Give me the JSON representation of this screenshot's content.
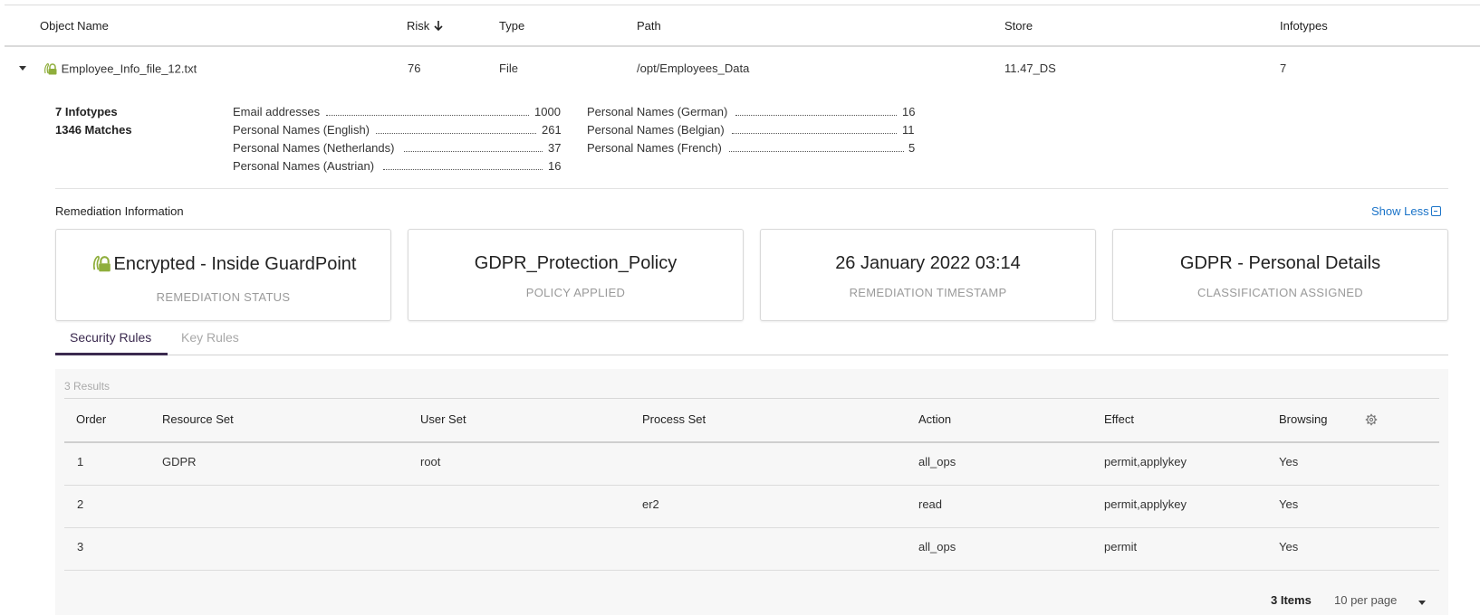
{
  "table": {
    "headers": {
      "object_name": "Object Name",
      "risk": "Risk",
      "type": "Type",
      "path": "Path",
      "store": "Store",
      "infotypes": "Infotypes"
    },
    "row": {
      "object_name": "Employee_Info_file_12.txt",
      "risk": "76",
      "type": "File",
      "path": "/opt/Employees_Data",
      "store": "11.47_DS",
      "infotypes": "7"
    }
  },
  "details": {
    "infotypes_summary": "7 Infotypes",
    "matches_summary": "1346 Matches",
    "infotypes_col1": [
      {
        "label": "Email addresses",
        "value": "1000"
      },
      {
        "label": "Personal Names (English)",
        "value": "261"
      },
      {
        "label": "Personal Names (Netherlands)",
        "value": "37"
      },
      {
        "label": "Personal Names (Austrian)",
        "value": "16"
      }
    ],
    "infotypes_col2": [
      {
        "label": "Personal Names (German)",
        "value": "16"
      },
      {
        "label": "Personal Names (Belgian)",
        "value": "11"
      },
      {
        "label": "Personal Names (French)",
        "value": "5"
      }
    ]
  },
  "remediation": {
    "title": "Remediation Information",
    "show_less": "Show Less",
    "cards": [
      {
        "value": "Encrypted - Inside GuardPoint",
        "label": "REMEDIATION STATUS"
      },
      {
        "value": "GDPR_Protection_Policy",
        "label": "POLICY APPLIED"
      },
      {
        "value": "26 January 2022 03:14",
        "label": "REMEDIATION TIMESTAMP"
      },
      {
        "value": "GDPR - Personal Details",
        "label": "CLASSIFICATION ASSIGNED"
      }
    ]
  },
  "tabs": {
    "security_rules": "Security Rules",
    "key_rules": "Key Rules"
  },
  "rules": {
    "results": "3 Results",
    "headers": {
      "order": "Order",
      "resource_set": "Resource Set",
      "user_set": "User Set",
      "process_set": "Process Set",
      "action": "Action",
      "effect": "Effect",
      "browsing": "Browsing"
    },
    "rows": [
      {
        "order": "1",
        "resource_set": "GDPR",
        "user_set": "root",
        "process_set": "",
        "action": "all_ops",
        "effect": "permit,applykey",
        "browsing": "Yes"
      },
      {
        "order": "2",
        "resource_set": "",
        "user_set": "",
        "process_set": "er2",
        "action": "read",
        "effect": "permit,applykey",
        "browsing": "Yes"
      },
      {
        "order": "3",
        "resource_set": "",
        "user_set": "",
        "process_set": "",
        "action": "all_ops",
        "effect": "permit",
        "browsing": "Yes"
      }
    ]
  },
  "pagination": {
    "items": "3 Items",
    "per_page": "10 per page"
  },
  "colors": {
    "accent": "#3b2a4f",
    "link": "#1a73c8",
    "lock_icon": "#8fae3c"
  }
}
